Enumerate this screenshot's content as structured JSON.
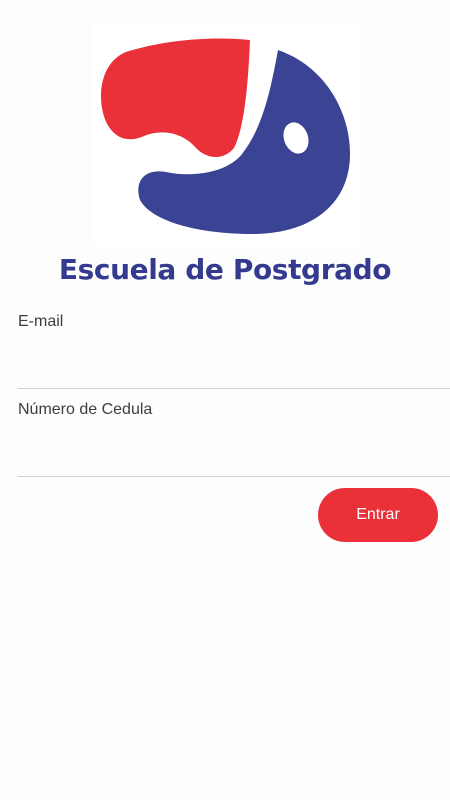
{
  "header": {
    "logo_icon": "fish-logo-icon",
    "title": "Escuela de Postgrado"
  },
  "form": {
    "email": {
      "label": "E-mail",
      "value": "",
      "placeholder": ""
    },
    "cedula": {
      "label": "Número de Cedula",
      "value": "",
      "placeholder": ""
    },
    "submit_label": "Entrar"
  },
  "colors": {
    "brand_blue": "#343b8e",
    "brand_red": "#ea3038",
    "background": "#fdfdfd",
    "divider": "#cfcfcf"
  }
}
